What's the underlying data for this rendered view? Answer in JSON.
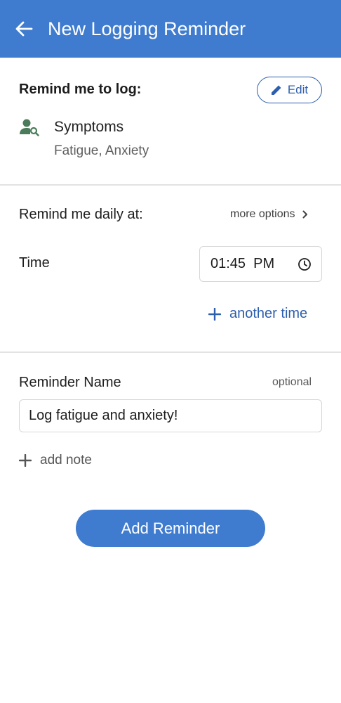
{
  "header": {
    "title": "New Logging Reminder",
    "back_icon": "arrow-left-icon"
  },
  "log_target": {
    "heading": "Remind me to log:",
    "edit_label": "Edit",
    "category": "Symptoms",
    "items": "Fatigue, Anxiety",
    "category_icon": "person-search-icon"
  },
  "schedule": {
    "heading": "Remind me daily at:",
    "more_options": "more options",
    "time_label": "Time",
    "time_value": "01:45  PM",
    "add_time_label": "another time"
  },
  "reminder_name": {
    "label": "Reminder Name",
    "optional_label": "optional",
    "value": "Log fatigue and anxiety!",
    "add_note_label": "add note"
  },
  "actions": {
    "submit_label": "Add Reminder"
  },
  "colors": {
    "primary": "#3f7ccf",
    "accent_text": "#2d5fae",
    "icon_green": "#4a7c59"
  }
}
